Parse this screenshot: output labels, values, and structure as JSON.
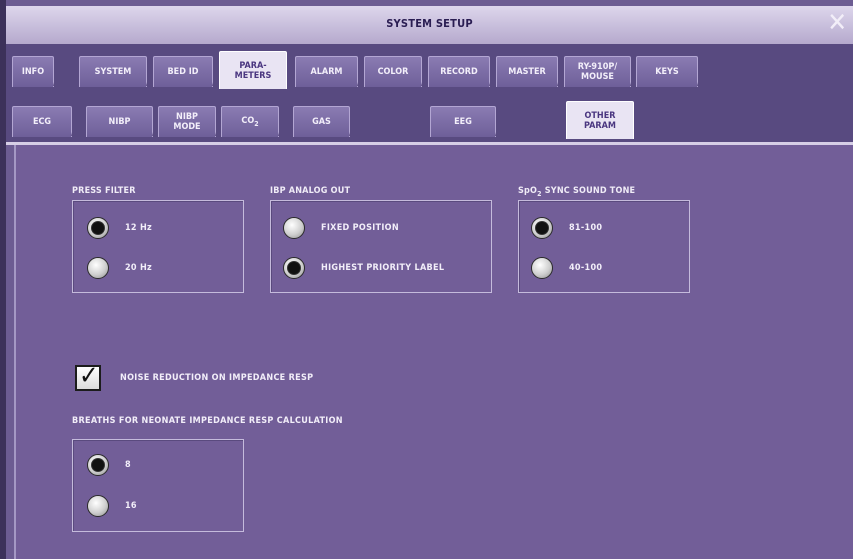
{
  "window": {
    "title": "SYSTEM SETUP"
  },
  "tabs_main": [
    {
      "label": "INFO"
    },
    {
      "label": "SYSTEM"
    },
    {
      "label": "BED ID"
    },
    {
      "label": "PARA-\nMETERS"
    },
    {
      "label": "ALARM"
    },
    {
      "label": "COLOR"
    },
    {
      "label": "RECORD"
    },
    {
      "label": "MASTER"
    },
    {
      "label": "RY-910P/\nMOUSE"
    },
    {
      "label": "KEYS"
    }
  ],
  "tabs_sub": [
    {
      "label": "ECG"
    },
    {
      "label": "NIBP"
    },
    {
      "label": "NIBP\nMODE"
    },
    {
      "label": "CO2"
    },
    {
      "label": "GAS"
    },
    {
      "label": "EEG"
    },
    {
      "label": "OTHER\nPARAM"
    }
  ],
  "press_filter": {
    "label": "PRESS FILTER",
    "options": [
      {
        "label": "12 Hz",
        "selected": true
      },
      {
        "label": "20 Hz",
        "selected": false
      }
    ]
  },
  "ibp_analog_out": {
    "label": "IBP ANALOG OUT",
    "options": [
      {
        "label": "FIXED POSITION",
        "selected": false
      },
      {
        "label": "HIGHEST PRIORITY LABEL",
        "selected": true
      }
    ]
  },
  "spo2_sync": {
    "label": "SpO2 SYNC SOUND TONE",
    "options": [
      {
        "label": "81-100",
        "selected": true
      },
      {
        "label": "40-100",
        "selected": false
      }
    ]
  },
  "noise_reduction": {
    "label": "NOISE REDUCTION ON IMPEDANCE RESP",
    "checked": true
  },
  "breaths_neonate": {
    "label": "BREATHS FOR NEONATE IMPEDANCE RESP CALCULATION",
    "options": [
      {
        "label": "8",
        "selected": true
      },
      {
        "label": "16",
        "selected": false
      }
    ]
  }
}
